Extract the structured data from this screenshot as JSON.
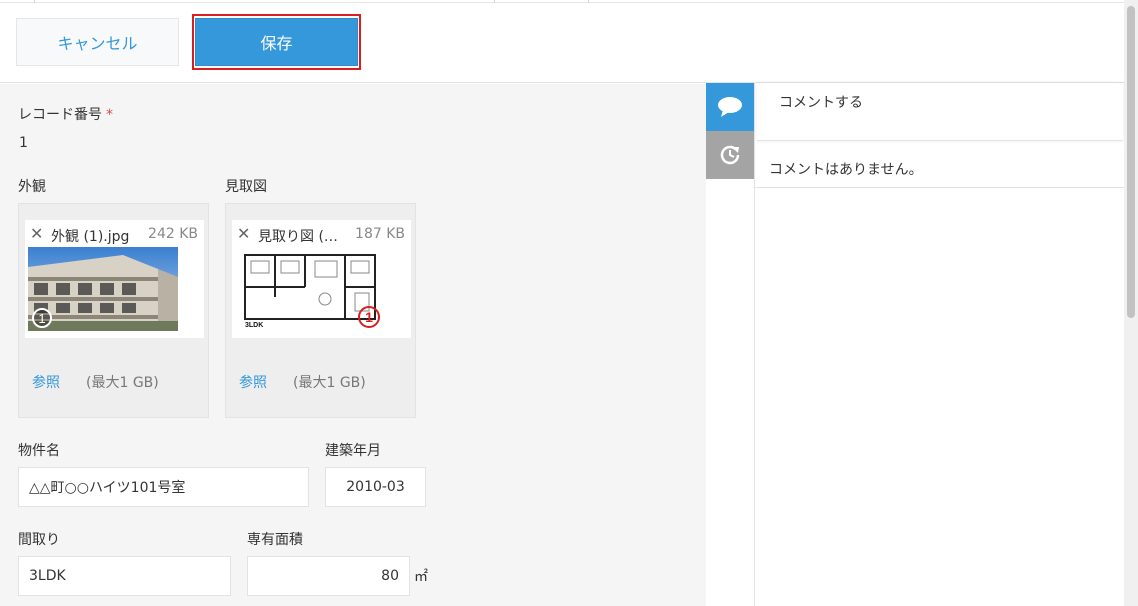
{
  "toolbar": {
    "cancel_label": "キャンセル",
    "save_label": "保存"
  },
  "record": {
    "label": "レコード番号",
    "required_mark": "*",
    "value": "1"
  },
  "attachments": [
    {
      "label": "外観",
      "file_name": "外観 (1).jpg",
      "file_size": "242 KB",
      "browse_label": "参照",
      "max_size": "(最大1 GB)"
    },
    {
      "label": "見取図",
      "file_name": "見取り図 (…",
      "file_size": "187 KB",
      "browse_label": "参照",
      "max_size": "(最大1 GB)"
    }
  ],
  "fields": {
    "property_name": {
      "label": "物件名",
      "value": "△△町○○ハイツ101号室"
    },
    "built_date": {
      "label": "建築年月",
      "value": "2010-03"
    },
    "layout": {
      "label": "間取り",
      "value": "3LDK"
    },
    "floor_area": {
      "label": "専有面積",
      "value": "80",
      "unit": "㎡"
    }
  },
  "floorplan_caption": "3LDK",
  "sidebar": {
    "comment_placeholder": "コメントする",
    "empty_message": "コメントはありません。"
  },
  "colors": {
    "accent": "#3498db",
    "highlight_border": "#d81e1e",
    "required": "#e74c3c"
  }
}
